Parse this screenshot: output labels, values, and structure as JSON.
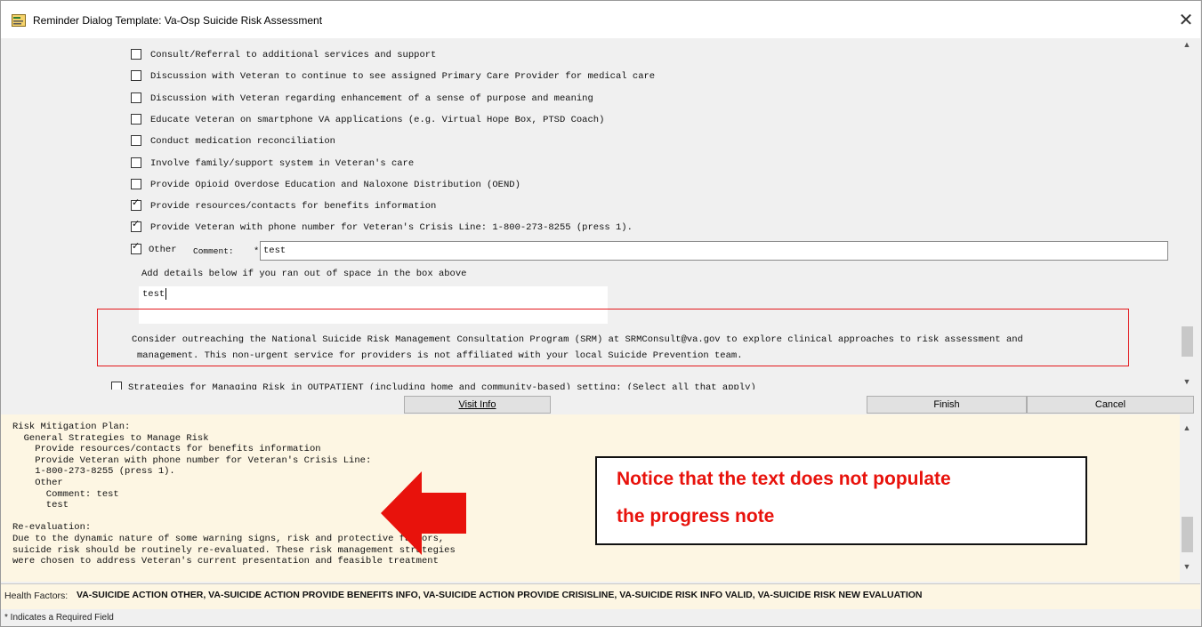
{
  "window": {
    "title": "Reminder Dialog Template: Va-Osp Suicide Risk Assessment",
    "close_glyph": "✕"
  },
  "checklist": [
    {
      "label": "Consult/Referral to additional services and support",
      "checked": false
    },
    {
      "label": "Discussion with Veteran to continue to see assigned Primary Care Provider for medical care",
      "checked": false
    },
    {
      "label": "Discussion with Veteran regarding enhancement of a sense of purpose and meaning",
      "checked": false
    },
    {
      "label": "Educate Veteran on smartphone VA applications (e.g. Virtual Hope Box, PTSD Coach)",
      "checked": false
    },
    {
      "label": "Conduct medication reconciliation",
      "checked": false
    },
    {
      "label": "Involve family/support system in Veteran's care",
      "checked": false
    },
    {
      "label": "Provide Opioid Overdose Education and Naloxone Distribution (OEND)",
      "checked": false
    },
    {
      "label": "Provide resources/contacts for benefits information",
      "checked": true
    },
    {
      "label": "Provide Veteran with phone number for Veteran's Crisis Line: 1-800-273-8255 (press 1).",
      "checked": true
    }
  ],
  "other": {
    "label": "Other",
    "checked": true,
    "comment_label": "Comment:",
    "required_marker": "*",
    "comment_value": "test",
    "details_prompt": "Add details below if you ran out of space in the box above",
    "details_value": "test"
  },
  "consult_notice": {
    "line1": "Consider outreaching the National Suicide Risk Management Consultation Program (SRM) at SRMConsult@va.gov to explore clinical approaches to risk assessment and",
    "line2": "management. This non-urgent service for providers is not affiliated with your local Suicide Prevention team."
  },
  "outpatient_item": {
    "label": "Strategies for Managing Risk in OUTPATIENT (including home and community-based) setting: (Select all that apply)",
    "checked": false
  },
  "buttons": {
    "visit_info": "Visit Info",
    "finish": "Finish",
    "cancel": "Cancel"
  },
  "progress_note": [
    "Risk Mitigation Plan:",
    "  General Strategies to Manage Risk",
    "    Provide resources/contacts for benefits information",
    "    Provide Veteran with phone number for Veteran's Crisis Line:",
    "    1-800-273-8255 (press 1).",
    "    Other",
    "      Comment: test",
    "      test",
    "",
    "Re-evaluation:",
    "Due to the dynamic nature of some warning signs, risk and protective factors,",
    "suicide risk should be routinely re-evaluated. These risk management strategies",
    "were chosen to address Veteran's current presentation and feasible treatment"
  ],
  "annotation": {
    "text_line1": "Notice that the text does not populate",
    "text_line2": "the progress note",
    "text_color": "#e8120c",
    "box_color": "#e3171b",
    "arrow_color": "#e8120c"
  },
  "health_factors": {
    "label": "Health Factors:",
    "value": "VA-SUICIDE ACTION OTHER, VA-SUICIDE ACTION PROVIDE BENEFITS INFO, VA-SUICIDE ACTION PROVIDE CRISISLINE, VA-SUICIDE RISK INFO VALID, VA-SUICIDE RISK NEW EVALUATION"
  },
  "footer": {
    "required_note": "* Indicates a Required Field"
  },
  "icons": {
    "title": "reminder-dialog-icon",
    "scroll_up": "▲",
    "scroll_down": "▼"
  }
}
